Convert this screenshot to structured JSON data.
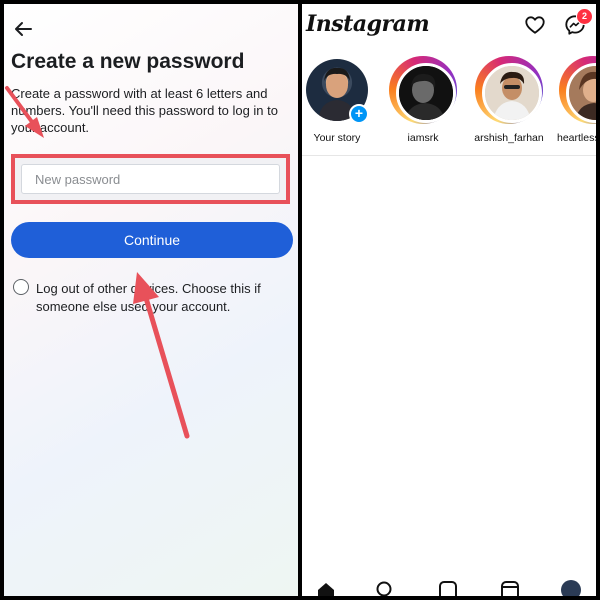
{
  "left_panel": {
    "title": "Create a new password",
    "subtitle": "Create a password with at least 6 letters and numbers. You'll need this password to log in to your account.",
    "password_field": {
      "placeholder": "New password",
      "value": ""
    },
    "continue_label": "Continue",
    "logout_option": "Log out of other devices. Choose this if someone else used your account.",
    "colors": {
      "button": "#1f5fd8",
      "highlight": "#e8515a"
    },
    "icons": {
      "back": "back-arrow-icon"
    }
  },
  "right_panel": {
    "app_name": "Instagram",
    "icons": {
      "notifications": "heart-icon",
      "messages": "messenger-icon"
    },
    "message_badge": "2",
    "stories": [
      {
        "name": "Your story"
      },
      {
        "name": "iamsrk"
      },
      {
        "name": "arshish_farhan"
      },
      {
        "name": "heartless"
      }
    ],
    "bottom_nav": [
      "home-icon",
      "search-icon",
      "add-post-icon",
      "reels-icon",
      "profile-icon"
    ]
  }
}
